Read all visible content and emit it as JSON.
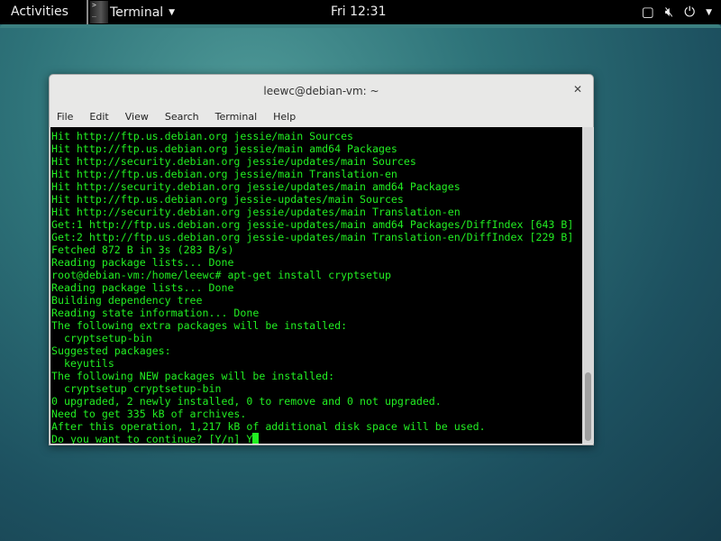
{
  "topbar": {
    "activities": "Activities",
    "app_name": "Terminal",
    "clock": "Fri 12:31",
    "icons": [
      "window-icon",
      "volume-muted-icon",
      "power-icon",
      "chevron-down-icon"
    ]
  },
  "window": {
    "title": "leewc@debian-vm: ~",
    "menu": [
      "File",
      "Edit",
      "View",
      "Search",
      "Terminal",
      "Help"
    ]
  },
  "terminal": {
    "lines": [
      "Hit http://ftp.us.debian.org jessie/main Sources",
      "Hit http://ftp.us.debian.org jessie/main amd64 Packages",
      "Hit http://security.debian.org jessie/updates/main Sources",
      "Hit http://ftp.us.debian.org jessie/main Translation-en",
      "Hit http://security.debian.org jessie/updates/main amd64 Packages",
      "Hit http://ftp.us.debian.org jessie-updates/main Sources",
      "Hit http://security.debian.org jessie/updates/main Translation-en",
      "Get:1 http://ftp.us.debian.org jessie-updates/main amd64 Packages/DiffIndex [643 B]",
      "Get:2 http://ftp.us.debian.org jessie-updates/main Translation-en/DiffIndex [229 B]",
      "Fetched 872 B in 3s (283 B/s)",
      "Reading package lists... Done",
      "root@debian-vm:/home/leewc# apt-get install cryptsetup",
      "Reading package lists... Done",
      "Building dependency tree",
      "Reading state information... Done",
      "The following extra packages will be installed:",
      "  cryptsetup-bin",
      "Suggested packages:",
      "  keyutils",
      "The following NEW packages will be installed:",
      "  cryptsetup cryptsetup-bin",
      "0 upgraded, 2 newly installed, 0 to remove and 0 not upgraded.",
      "Need to get 335 kB of archives.",
      "After this operation, 1,217 kB of additional disk space will be used.",
      "Do you want to continue? [Y/n] Y"
    ],
    "text_color": "#22ee22",
    "background": "#000000"
  }
}
